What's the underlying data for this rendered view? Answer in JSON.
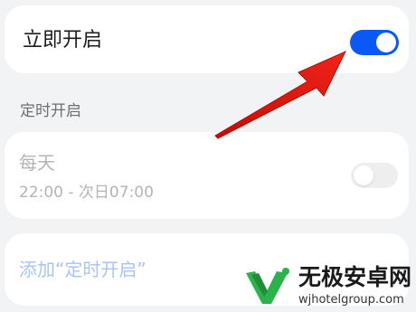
{
  "immediate": {
    "title": "立即开启",
    "enabled": true
  },
  "schedule_section": {
    "label": "定时开启"
  },
  "schedule_item": {
    "name": "每天",
    "time_range": "22:00 - 次日07:00",
    "enabled": false
  },
  "add_schedule": {
    "label": "添加“定时开启”"
  },
  "watermark": {
    "title": "无极安卓网",
    "url": "wjhotelgroup.com"
  },
  "colors": {
    "accent": "#0a59f7",
    "arrow": "#e3170f",
    "watermark_green": "#29b34a"
  }
}
